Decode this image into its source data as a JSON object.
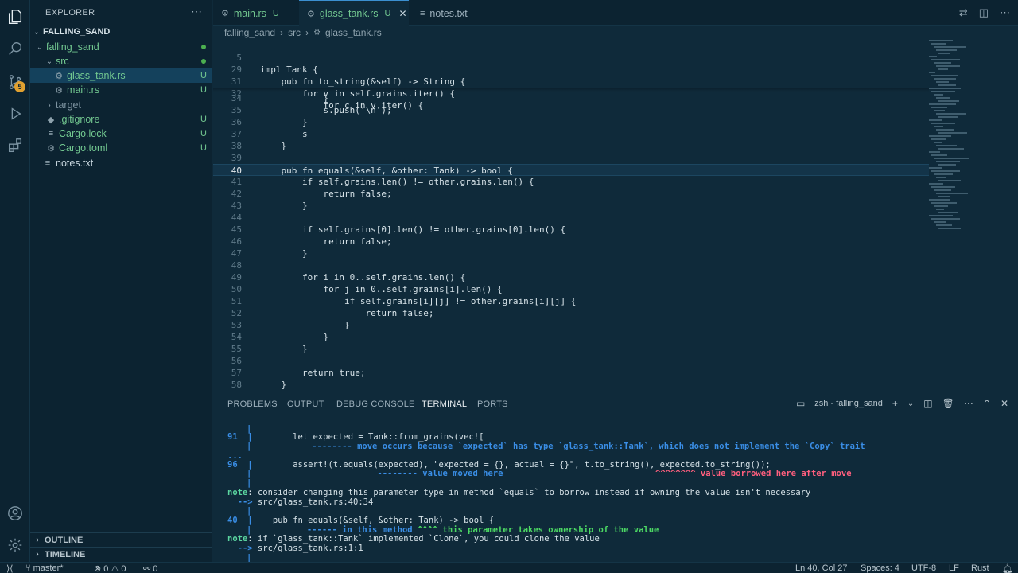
{
  "explorer": {
    "title": "EXPLORER",
    "items": [
      {
        "label": "FALLING_SAND",
        "status": ""
      },
      {
        "label": "falling_sand",
        "status": "dot"
      },
      {
        "label": "src",
        "status": "dot"
      },
      {
        "label": "glass_tank.rs",
        "status": "U"
      },
      {
        "label": "main.rs",
        "status": "U"
      },
      {
        "label": "target",
        "status": ""
      },
      {
        "label": ".gitignore",
        "status": "U"
      },
      {
        "label": "Cargo.lock",
        "status": "U"
      },
      {
        "label": "Cargo.toml",
        "status": "U"
      },
      {
        "label": "notes.txt",
        "status": ""
      }
    ],
    "outline": "OUTLINE",
    "timeline": "TIMELINE"
  },
  "activity": {
    "scm_badge": "5"
  },
  "tabs": [
    {
      "label": "main.rs",
      "mod": "U"
    },
    {
      "label": "glass_tank.rs",
      "mod": "U"
    },
    {
      "label": "notes.txt",
      "mod": ""
    }
  ],
  "breadcrumb": [
    "falling_sand",
    "src",
    "glass_tank.rs"
  ],
  "editor": {
    "sticky": [
      {
        "ln": "5",
        "code": "impl Tank {"
      },
      {
        "ln": "29",
        "code": "    pub fn to_string(&self) -> String {"
      },
      {
        "ln": "31",
        "code": "        for v in self.grains.iter() {"
      },
      {
        "ln": "32",
        "code": "            for c in v.iter() {"
      }
    ],
    "lines": [
      {
        "ln": "34",
        "code": "            }"
      },
      {
        "ln": "35",
        "code": "            s.push('\\n');"
      },
      {
        "ln": "36",
        "code": "        }"
      },
      {
        "ln": "37",
        "code": "        s"
      },
      {
        "ln": "38",
        "code": "    }"
      },
      {
        "ln": "39",
        "code": ""
      },
      {
        "ln": "40",
        "code": "    pub fn equals(&self, &other: Tank) -> bool {"
      },
      {
        "ln": "41",
        "code": "        if self.grains.len() != other.grains.len() {"
      },
      {
        "ln": "42",
        "code": "            return false;"
      },
      {
        "ln": "43",
        "code": "        }"
      },
      {
        "ln": "44",
        "code": ""
      },
      {
        "ln": "45",
        "code": "        if self.grains[0].len() != other.grains[0].len() {"
      },
      {
        "ln": "46",
        "code": "            return false;"
      },
      {
        "ln": "47",
        "code": "        }"
      },
      {
        "ln": "48",
        "code": ""
      },
      {
        "ln": "49",
        "code": "        for i in 0..self.grains.len() {"
      },
      {
        "ln": "50",
        "code": "            for j in 0..self.grains[i].len() {"
      },
      {
        "ln": "51",
        "code": "                if self.grains[i][j] != other.grains[i][j] {"
      },
      {
        "ln": "52",
        "code": "                    return false;"
      },
      {
        "ln": "53",
        "code": "                }"
      },
      {
        "ln": "54",
        "code": "            }"
      },
      {
        "ln": "55",
        "code": "        }"
      },
      {
        "ln": "56",
        "code": ""
      },
      {
        "ln": "57",
        "code": "        return true;"
      },
      {
        "ln": "58",
        "code": "    }"
      }
    ]
  },
  "panel": {
    "tabs": [
      "PROBLEMS",
      "OUTPUT",
      "DEBUG CONSOLE",
      "TERMINAL",
      "PORTS"
    ],
    "active_tab": "TERMINAL",
    "terminal_name": "zsh - falling_sand"
  },
  "terminal": {
    "l1_num": "91",
    "l1_code": "        let expected = Tank::from_grains(vec![",
    "l2_marker": "            --------",
    "l2_msg": " move occurs because `expected` has type `glass_tank::Tank`, which does not implement the `Copy` trait",
    "l3": "...",
    "l4_num": "96",
    "l4_code": "        assert!(t.equals(expected), \"expected = {}, actual = {}\", t.to_string(), expected.to_string());",
    "l5_marker": "                         --------",
    "l5_msg": " value moved here",
    "l5_marker2": "^^^^^^^^",
    "l5_msg2": " value borrowed here after move",
    "l6_note": "note",
    "l6_text": ": consider changing this parameter type in method `equals` to borrow instead if owning the value isn't necessary",
    "l7_arrow": "  -->",
    "l7_path": " src/glass_tank.rs:40:34",
    "l8_num": "40",
    "l8_code": "    pub fn equals(&self, &other: Tank) -> bool {",
    "l9_marker": "           ------",
    "l9_msg": " in this method",
    "l9_marker2": " ^^^^",
    "l9_msg2": " this parameter takes ownership of the value",
    "l10_note": "note",
    "l10_text": ": if `glass_tank::Tank` implemented `Clone`, you could clone the value",
    "l11_arrow": "  -->",
    "l11_path": " src/glass_tank.rs:1:1"
  },
  "status": {
    "branch": "master*",
    "errors": "0",
    "warnings": "0",
    "ports": "0",
    "position": "Ln 40, Col 27",
    "spaces": "Spaces: 4",
    "encoding": "UTF-8",
    "eol": "LF",
    "language": "Rust"
  }
}
